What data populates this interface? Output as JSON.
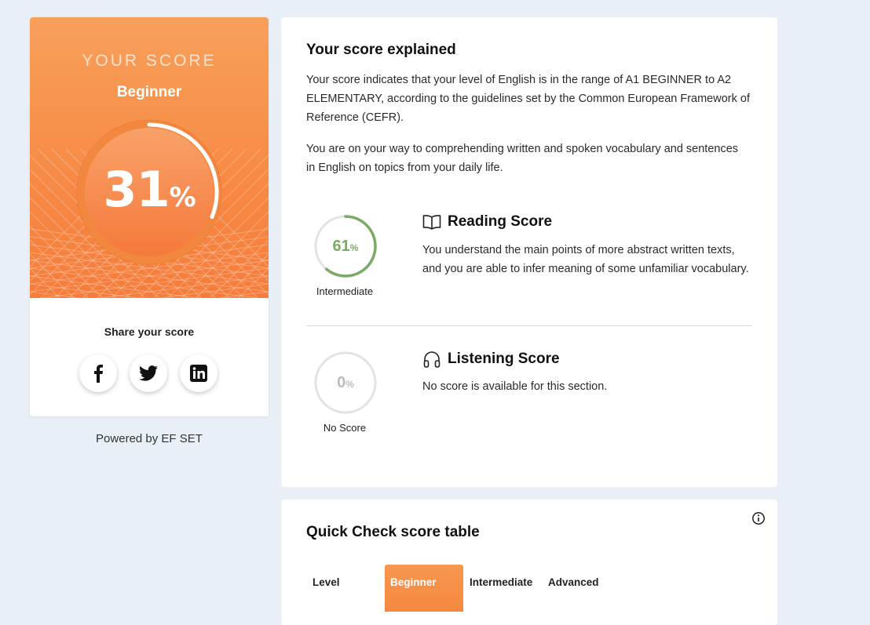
{
  "score_card": {
    "label": "YOUR SCORE",
    "level": "Beginner",
    "score_value": "31",
    "score_sign": "%",
    "score_fraction": 0.31,
    "share_title": "Share your score",
    "social": [
      {
        "name": "facebook-icon"
      },
      {
        "name": "twitter-icon"
      },
      {
        "name": "linkedin-icon"
      }
    ],
    "colors": {
      "accent": "#f78b46",
      "accent_light": "#f7a05a"
    }
  },
  "powered_by": "Powered by EF SET",
  "explain": {
    "title": "Your score explained",
    "paragraph1": "Your score indicates that your level of English is in the range of A1 BEGINNER to A2 ELEMENTARY, according to the guidelines set by the Common European Framework of Reference (CEFR).",
    "paragraph2": "You are on your way to comprehending written and spoken vocabulary and sentences in English on topics from your daily life.",
    "reading": {
      "score_value": "61",
      "score_sign": "%",
      "score_fraction": 0.61,
      "level": "Intermediate",
      "title": "Reading Score",
      "icon": "book-icon",
      "description": "You understand the main points of more abstract written texts, and you are able to infer meaning of some unfamiliar vocabulary.",
      "color": "#7aaa63"
    },
    "listening": {
      "score_value": "0",
      "score_sign": "%",
      "score_fraction": 0,
      "level": "No Score",
      "title": "Listening Score",
      "icon": "headphones-icon",
      "description": "No score is available for this section.",
      "color": "#bbbbbb"
    }
  },
  "score_table": {
    "title": "Quick Check score table",
    "columns": [
      "Level",
      "Beginner",
      "Intermediate",
      "Advanced"
    ],
    "active_column": "Beginner"
  }
}
